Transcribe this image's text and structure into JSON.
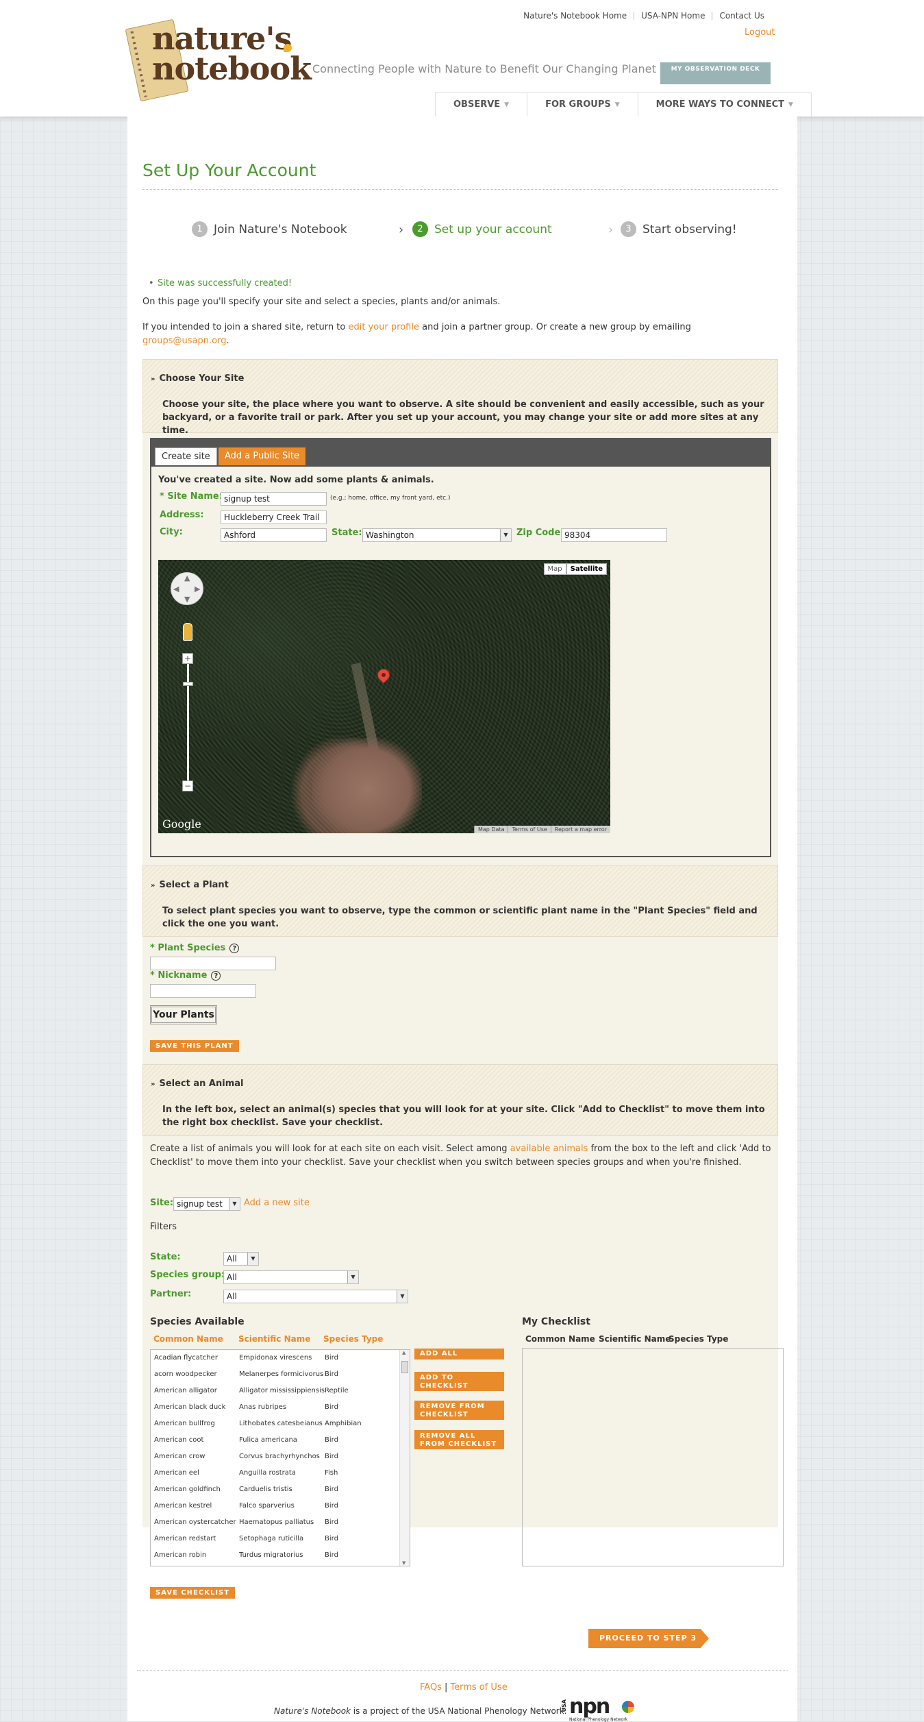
{
  "header": {
    "top_links": [
      "Nature's Notebook Home",
      "USA-NPN Home",
      "Contact Us"
    ],
    "logout": "Logout",
    "logo_line1": "nature's",
    "logo_line2": "notebook",
    "tagline": "Connecting People with Nature to Benefit Our Changing Planet",
    "obs_deck_label": "MY OBSERVATION DECK",
    "nav": [
      "OBSERVE",
      "FOR GROUPS",
      "MORE WAYS TO CONNECT"
    ]
  },
  "page": {
    "title": "Set Up Your Account",
    "steps": [
      {
        "num": "1",
        "label": "Join Nature's Notebook"
      },
      {
        "num": "2",
        "label": "Set up your account"
      },
      {
        "num": "3",
        "label": "Start observing!"
      }
    ],
    "success_msg": "Site was successfully created!",
    "intro1": "On this page you'll specify your site and select a species, plants and/or animals.",
    "intro2_a": "If you intended to join a shared site, return to ",
    "intro2_link": "edit your profile",
    "intro2_b": " and join a partner group. Or create a new group by emailing ",
    "intro2_email": "groups@usapn.org",
    "intro2_c": "."
  },
  "site_section": {
    "title": "Choose Your Site",
    "desc": "Choose your site, the place where you want to observe. A site should be convenient and easily accessible, such as your backyard, or a favorite trail or park. After you set up your account, you may change your site or add more sites at any time.",
    "tabs": [
      "Create site",
      "Add a Public Site"
    ],
    "created_msg": "You've created a site. Now add some plants & animals.",
    "site_name_label": "* Site Name:",
    "site_name_value": "signup test",
    "site_name_hint": "(e.g.; home, office, my front yard, etc.)",
    "address_label": "Address:",
    "address_value": "Huckleberry Creek Trail",
    "city_label": "City:",
    "city_value": "Ashford",
    "state_label": "State:",
    "state_value": "Washington",
    "zip_label": "Zip Code:",
    "zip_value": "98304",
    "map": {
      "type_buttons": [
        "Map",
        "Satellite"
      ],
      "selected_type": "Satellite",
      "logo": "Google",
      "attribution": [
        "Map Data",
        "Terms of Use",
        "Report a map error"
      ]
    }
  },
  "plant_section": {
    "title": "Select a Plant",
    "desc": "To select plant species you want to observe, type the common or scientific plant name in the \"Plant Species\" field and click the one you want.",
    "species_label": "* Plant Species",
    "nickname_label": "* Nickname",
    "your_plants": "Your Plants",
    "save_button": "SAVE THIS PLANT"
  },
  "animal_section": {
    "title": "Select an Animal",
    "desc": "In the left box, select an animal(s) species that you will look for at your site. Click \"Add to Checklist\" to move them into the right box checklist. Save your checklist.",
    "intro_a": "Create a list of animals you will look for at each site on each visit. Select among ",
    "intro_link": "available animals",
    "intro_b": " from the box to the left and click 'Add to Checklist' to move them into your checklist. Save your checklist when you switch between species groups and when you're finished.",
    "site_label": "Site:",
    "site_value": "signup test",
    "add_site_link": "Add a new site",
    "filters_label": "Filters",
    "state_label": "State:",
    "state_value": "All",
    "group_label": "Species group:",
    "group_value": "All",
    "partner_label": "Partner:",
    "partner_value": "All",
    "available_title": "Species Available",
    "checklist_title": "My Checklist",
    "columns": [
      "Common Name",
      "Scientific Name",
      "Species Type"
    ],
    "species": [
      [
        "Acadian flycatcher",
        "Empidonax virescens",
        "Bird"
      ],
      [
        "acorn woodpecker",
        "Melanerpes formicivorus",
        "Bird"
      ],
      [
        "American alligator",
        "Alligator mississippiensis",
        "Reptile"
      ],
      [
        "American black duck",
        "Anas rubripes",
        "Bird"
      ],
      [
        "American bullfrog",
        "Lithobates catesbeianus",
        "Amphibian"
      ],
      [
        "American coot",
        "Fulica americana",
        "Bird"
      ],
      [
        "American crow",
        "Corvus brachyrhynchos",
        "Bird"
      ],
      [
        "American eel",
        "Anguilla rostrata",
        "Fish"
      ],
      [
        "American goldfinch",
        "Carduelis tristis",
        "Bird"
      ],
      [
        "American kestrel",
        "Falco sparverius",
        "Bird"
      ],
      [
        "American oystercatcher",
        "Haematopus palliatus",
        "Bird"
      ],
      [
        "American redstart",
        "Setophaga ruticilla",
        "Bird"
      ],
      [
        "American robin",
        "Turdus migratorius",
        "Bird"
      ]
    ],
    "buttons": [
      "ADD ALL",
      "ADD TO CHECKLIST",
      "REMOVE FROM CHECKLIST",
      "REMOVE ALL FROM CHECKLIST"
    ],
    "save_checklist": "SAVE CHECKLIST"
  },
  "proceed_button": "PROCEED TO STEP 3",
  "footer": {
    "links": [
      "FAQs",
      "Terms of Use"
    ],
    "credit_em": "Nature's Notebook",
    "credit_rest": " is a project of the USA National Phenology Network.",
    "logo_text": "npn",
    "logo_usa": "USA",
    "logo_sub": "National Phenology Network"
  },
  "colors": {
    "accent_orange": "#e98b2b",
    "accent_green": "#4b9a2e",
    "logo_brown": "#5b3a20"
  }
}
